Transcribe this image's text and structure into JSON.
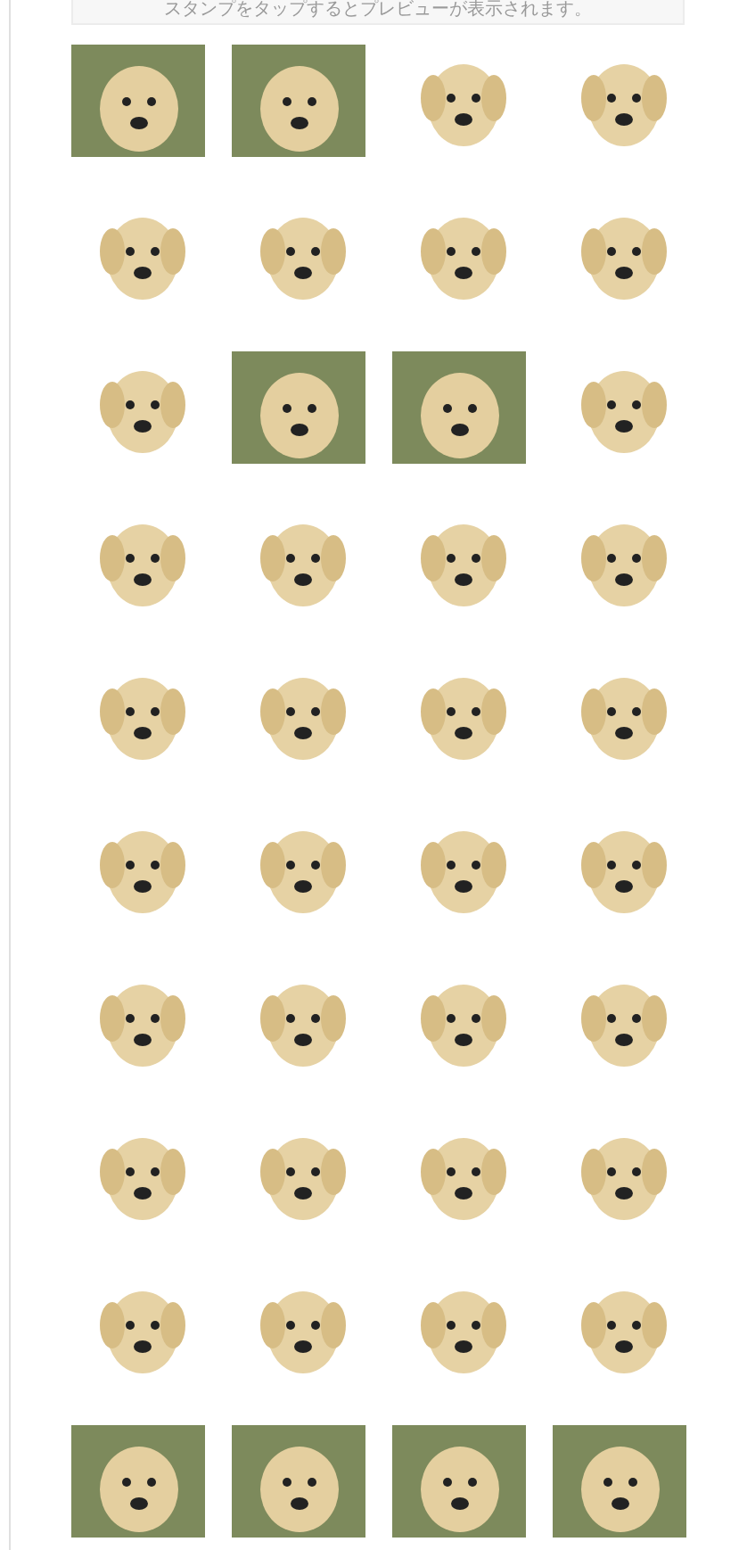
{
  "notice": "スタンプをタップするとプレビューが表示されます。",
  "stickers": [
    {
      "kind": "photo"
    },
    {
      "kind": "photo"
    },
    {
      "kind": "cutout"
    },
    {
      "kind": "cutout"
    },
    {
      "kind": "cutout"
    },
    {
      "kind": "cutout"
    },
    {
      "kind": "cutout"
    },
    {
      "kind": "cutout"
    },
    {
      "kind": "cutout"
    },
    {
      "kind": "photo"
    },
    {
      "kind": "photo"
    },
    {
      "kind": "cutout"
    },
    {
      "kind": "cutout"
    },
    {
      "kind": "cutout"
    },
    {
      "kind": "cutout"
    },
    {
      "kind": "cutout"
    },
    {
      "kind": "cutout"
    },
    {
      "kind": "cutout"
    },
    {
      "kind": "cutout"
    },
    {
      "kind": "cutout"
    },
    {
      "kind": "cutout"
    },
    {
      "kind": "cutout"
    },
    {
      "kind": "cutout"
    },
    {
      "kind": "cutout"
    },
    {
      "kind": "cutout"
    },
    {
      "kind": "cutout"
    },
    {
      "kind": "cutout"
    },
    {
      "kind": "cutout"
    },
    {
      "kind": "cutout"
    },
    {
      "kind": "cutout"
    },
    {
      "kind": "cutout"
    },
    {
      "kind": "cutout"
    },
    {
      "kind": "cutout"
    },
    {
      "kind": "cutout"
    },
    {
      "kind": "cutout"
    },
    {
      "kind": "cutout"
    },
    {
      "kind": "photo"
    },
    {
      "kind": "photo"
    },
    {
      "kind": "photo"
    },
    {
      "kind": "photo"
    }
  ]
}
